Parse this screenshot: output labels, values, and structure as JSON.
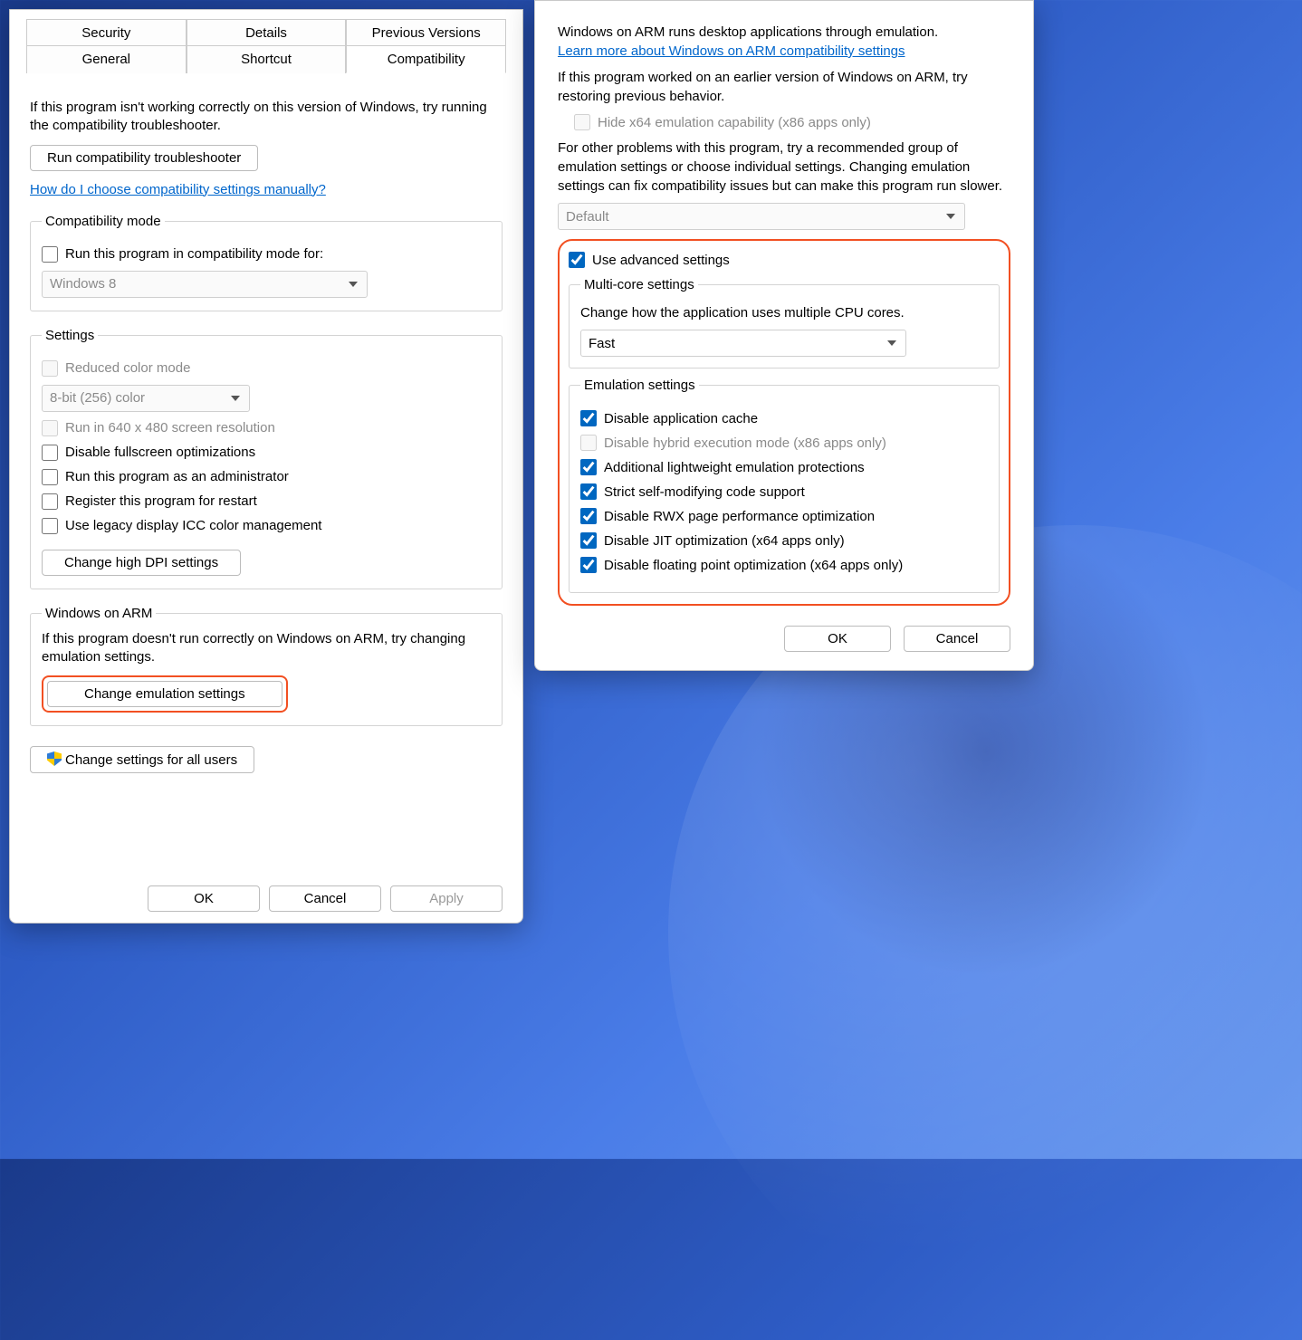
{
  "leftDialog": {
    "tabs": {
      "security": "Security",
      "details": "Details",
      "previous": "Previous Versions",
      "general": "General",
      "shortcut": "Shortcut",
      "compatibility": "Compatibility"
    },
    "intro": "If this program isn't working correctly on this version of Windows, try running the compatibility troubleshooter.",
    "troubleshootBtn": "Run compatibility troubleshooter",
    "helpLink": "How do I choose compatibility settings manually?",
    "compatMode": {
      "legend": "Compatibility mode",
      "checkbox": "Run this program in compatibility mode for:",
      "combo": "Windows 8"
    },
    "settings": {
      "legend": "Settings",
      "reducedColor": "Reduced color mode",
      "colorCombo": "8-bit (256) color",
      "run640": "Run in 640 x 480 screen resolution",
      "disableFullscreen": "Disable fullscreen optimizations",
      "runAdmin": "Run this program as an administrator",
      "registerRestart": "Register this program for restart",
      "legacyICC": "Use legacy display ICC color management",
      "highDpiBtn": "Change high DPI settings"
    },
    "arm": {
      "legend": "Windows on ARM",
      "text": "If this program doesn't run correctly on Windows on ARM, try changing emulation settings.",
      "btn": "Change emulation settings"
    },
    "allUsersBtn": "Change settings for all users",
    "footer": {
      "ok": "OK",
      "cancel": "Cancel",
      "apply": "Apply"
    }
  },
  "rightDialog": {
    "intro1": "Windows on ARM runs desktop applications through emulation.",
    "learnLink": "Learn more about Windows on ARM compatibility settings",
    "intro2": "If this program worked on an earlier version of Windows on ARM, try restoring previous behavior.",
    "hideX64": "Hide x64 emulation capability (x86 apps only)",
    "intro3": "For other problems with this program, try a recommended group of emulation settings or choose individual settings.  Changing emulation settings can fix compatibility issues but can make this program run slower.",
    "presetCombo": "Default",
    "useAdvanced": "Use advanced settings",
    "multicore": {
      "legend": "Multi-core settings",
      "desc": "Change how the application uses multiple CPU cores.",
      "combo": "Fast"
    },
    "emulation": {
      "legend": "Emulation settings",
      "disableCache": "Disable application cache",
      "disableHybrid": "Disable hybrid execution mode (x86 apps only)",
      "additionalProt": "Additional lightweight emulation protections",
      "strictSMC": "Strict self-modifying code support",
      "disableRWX": "Disable RWX page performance optimization",
      "disableJIT": "Disable JIT optimization (x64 apps only)",
      "disableFP": "Disable floating point optimization (x64 apps only)"
    },
    "footer": {
      "ok": "OK",
      "cancel": "Cancel"
    }
  }
}
